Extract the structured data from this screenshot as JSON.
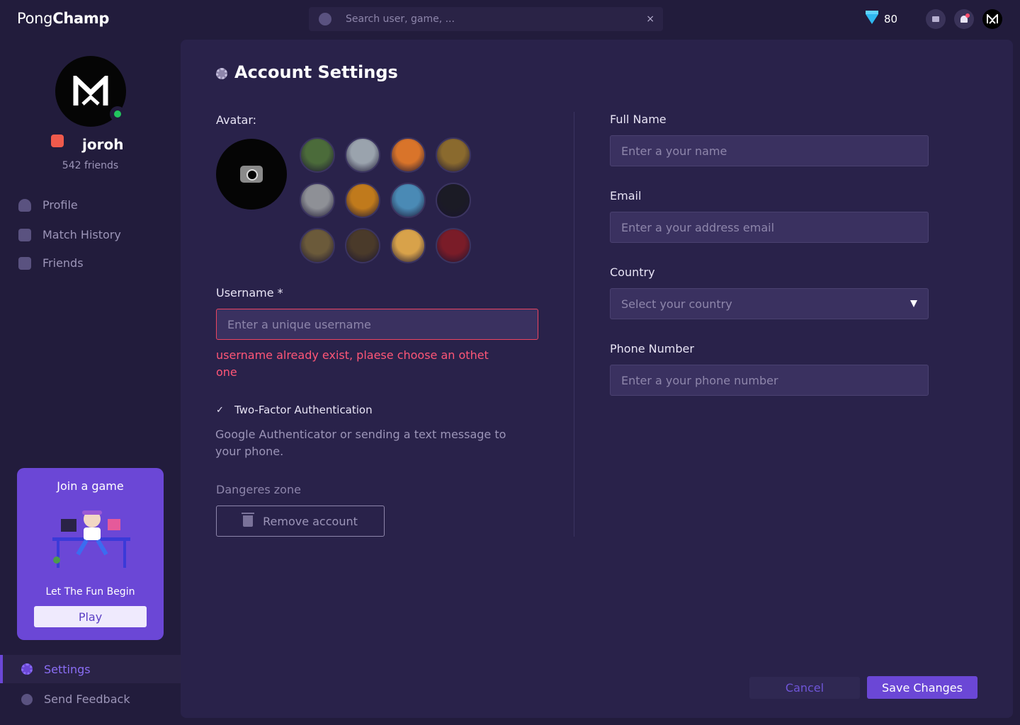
{
  "header": {
    "logo_light": "Pong",
    "logo_bold": "Champ",
    "search_placeholder": "Search user, game, ...",
    "clear_glyph": "×",
    "coins": "80",
    "icons": [
      "search-icon",
      "close-icon",
      "diamond-icon",
      "mail-icon",
      "bell-icon",
      "avatar"
    ]
  },
  "sidebar": {
    "username": "joroh",
    "friends": "542 friends",
    "status": "online",
    "nav": [
      {
        "label": "Profile",
        "icon": "person-icon"
      },
      {
        "label": "Match History",
        "icon": "group-icon"
      },
      {
        "label": "Friends",
        "icon": "document-icon"
      }
    ],
    "promo": {
      "title": "Join a game",
      "subtitle": "Let The Fun Begin",
      "button": "Play"
    },
    "settings": "Settings",
    "feedback": "Send Feedback"
  },
  "main": {
    "title": "Account Settings",
    "avatar_label": "Avatar:",
    "avatar_colors": [
      "#4b6b3a",
      "#9aa3ad",
      "#d9742a",
      "#8a6a2e",
      "#8e9096",
      "#c07a1c",
      "#4a8ab5",
      "#1b1b25",
      "#6b5a3a",
      "#4a3a2a",
      "#d8a24a",
      "#7a1c28"
    ],
    "username_label": "Username *",
    "username_placeholder": "Enter a unique username",
    "username_error": "username already exist, plaese choose an othet one",
    "twofa_label": "Two-Factor Authentication",
    "twofa_help": "Google Authenticator or sending a text message to your phone.",
    "danger_label": "Dangeres zone",
    "remove_button": "Remove account",
    "fullname_label": "Full Name",
    "fullname_placeholder": "Enter a your name",
    "email_label": "Email",
    "email_placeholder": "Enter a your address email",
    "country_label": "Country",
    "country_value": "Select your country",
    "phone_label": "Phone Number",
    "phone_placeholder": "Enter a your phone number",
    "cancel_button": "Cancel",
    "save_button": "Save Changes"
  },
  "colors": {
    "accent": "#6b47d6",
    "error": "#ff5677",
    "online": "#22c55e",
    "background": "#221c3c"
  }
}
